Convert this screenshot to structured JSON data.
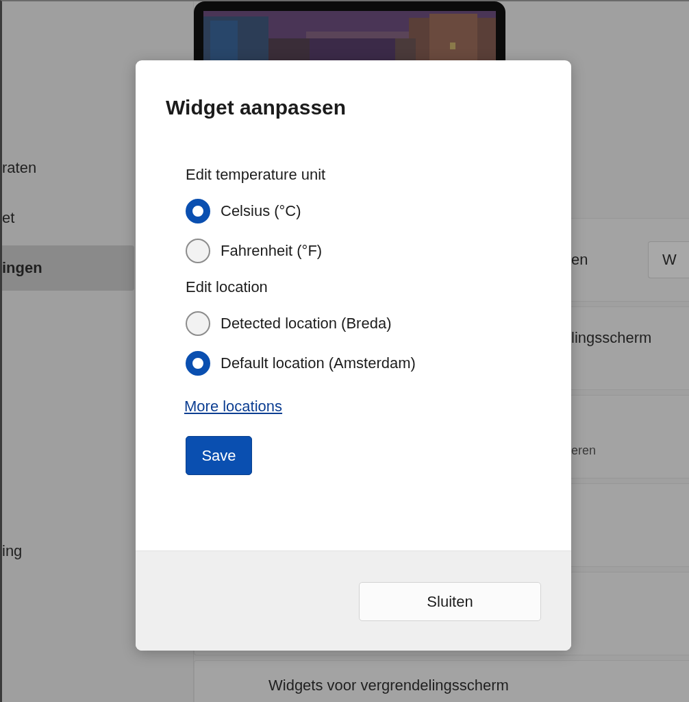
{
  "background": {
    "sidebar": {
      "items": [
        {
          "label": "raten",
          "selected": false
        },
        {
          "label": "et",
          "selected": false
        },
        {
          "label": "ingen",
          "selected": true
        }
      ],
      "lower_items": [
        {
          "label": "ing",
          "selected": false
        }
      ]
    },
    "cards": [
      {
        "kind": "partly_hidden",
        "label": "en",
        "button": "W"
      },
      {
        "kind": "partly_hidden",
        "label": "lingsscherm"
      },
      {
        "kind": "partly_hidden",
        "description": "eren"
      },
      {
        "kind": "partly_hidden"
      },
      {
        "kind": "partly_hidden"
      },
      {
        "kind": "full",
        "label": "Widgets voor vergrendelingsscherm"
      }
    ]
  },
  "dialog": {
    "title": "Widget aanpassen",
    "sections": [
      {
        "heading": "Edit temperature unit",
        "options": [
          {
            "label": "Celsius (°C)",
            "selected": true
          },
          {
            "label": "Fahrenheit (°F)",
            "selected": false
          }
        ]
      },
      {
        "heading": "Edit location",
        "options": [
          {
            "label": "Detected location (Breda)",
            "selected": false
          },
          {
            "label": "Default location (Amsterdam)",
            "selected": true
          }
        ]
      }
    ],
    "link": "More locations",
    "save_button": "Save",
    "close_button": "Sluiten"
  }
}
